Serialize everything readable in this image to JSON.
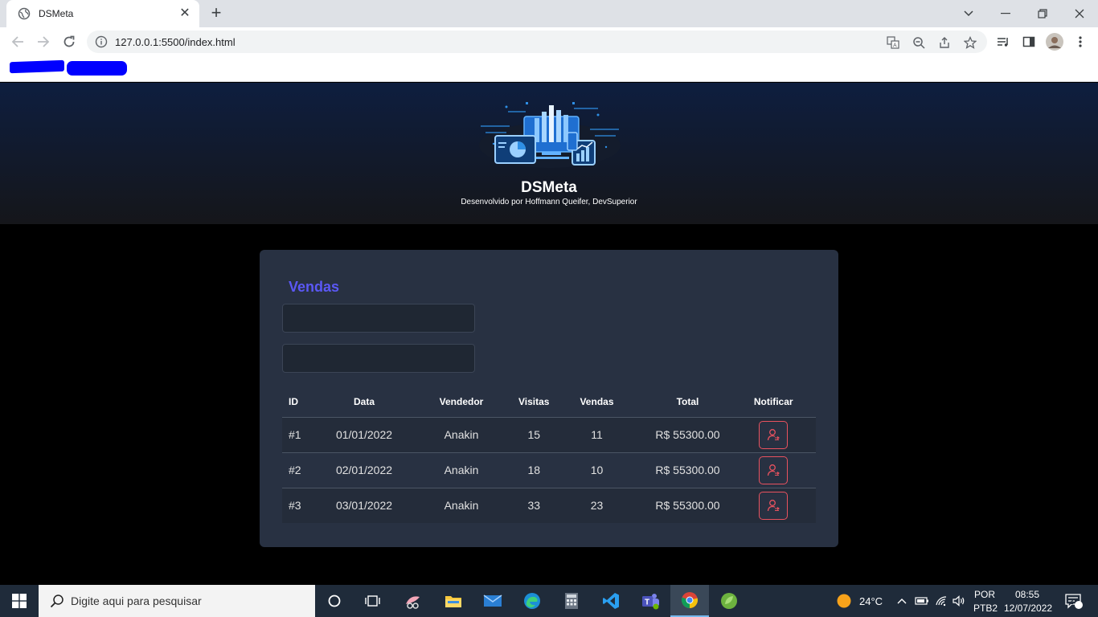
{
  "browser": {
    "tab_title": "DSMeta",
    "tab_close": "✕",
    "new_tab": "+",
    "url": "127.0.0.1:5500/index.html"
  },
  "header": {
    "brand": "DSMeta",
    "subtitle": "Desenvolvido por Hoffmann Queifer, DevSuperior"
  },
  "sales": {
    "title": "Vendas",
    "min_date": "",
    "max_date": "",
    "columns": [
      "ID",
      "Data",
      "Vendedor",
      "Visitas",
      "Vendas",
      "Total",
      "Notificar"
    ],
    "rows": [
      {
        "id": "#1",
        "date": "01/01/2022",
        "seller": "Anakin",
        "visits": "15",
        "deals": "11",
        "total": "R$ 55300.00"
      },
      {
        "id": "#2",
        "date": "02/01/2022",
        "seller": "Anakin",
        "visits": "18",
        "deals": "10",
        "total": "R$ 55300.00"
      },
      {
        "id": "#3",
        "date": "03/01/2022",
        "seller": "Anakin",
        "visits": "33",
        "deals": "23",
        "total": "R$ 55300.00"
      }
    ]
  },
  "taskbar": {
    "search_placeholder": "Digite aqui para pesquisar",
    "weather": "24°C",
    "lang_line1": "POR",
    "lang_line2": "PTB2",
    "time": "08:55",
    "date": "12/07/2022",
    "notifications": "2"
  },
  "colors": {
    "accent": "#5b58f5",
    "card": "#283142",
    "notify": "#e9525f"
  }
}
